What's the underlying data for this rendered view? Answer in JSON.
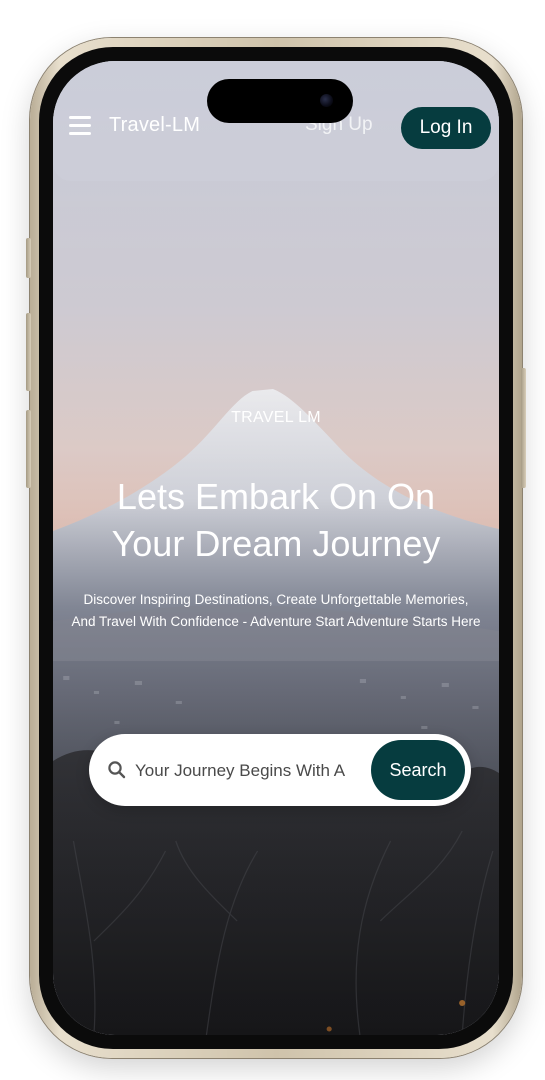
{
  "nav": {
    "brand": "Travel-LM",
    "signup_label": "Sign Up",
    "login_label": "Log In"
  },
  "hero": {
    "eyebrow": "TRAVEL LM",
    "title_line1": "Lets Embark On On",
    "title_line2": "Your Dream Journey",
    "subtitle": "Discover Inspiring Destinations, Create Unforgettable Memories, And Travel With Confidence - Adventure Start Adventure Starts Here"
  },
  "search": {
    "placeholder": "Your Journey Begins With A",
    "button_label": "Search"
  },
  "colors": {
    "accent": "#063c3f",
    "text_on_image": "#ffffff"
  }
}
